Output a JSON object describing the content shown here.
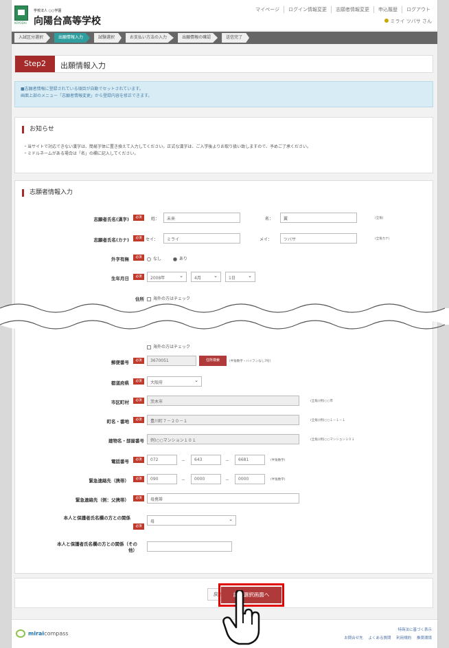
{
  "header": {
    "school_small": "学校法人 ○○学園",
    "school_name": "向陽台高等学校",
    "nav": [
      "マイページ",
      "ログイン情報変更",
      "志願者情報変更",
      "申込履歴",
      "ログアウト"
    ],
    "user": "ミライ ツバサ さん"
  },
  "steps": [
    "入試区分選択",
    "出願情報入力",
    "試験選択",
    "お支払い方法の入力",
    "出願情報の確認",
    "送信完了"
  ],
  "step_title": {
    "badge": "Step2",
    "title": "出願情報入力"
  },
  "info": [
    "■志願者情報に登録されている項目が自動でセットされています。",
    "画面上部のメニュー「志願者情報変更」から登録内容を修正できます。"
  ],
  "notice": {
    "heading": "お知らせ",
    "lines": [
      "・当サイトで対応できない漢字は、簡易字体に置き換えて入力してください。正式な漢字は、ご入学後よりお取り扱い致しますので、予めご了承ください。",
      "・ミドルネームがある場合は「名」の欄に記入してください。"
    ]
  },
  "form": {
    "heading": "志願者情報入力",
    "required": "必須",
    "name_kanji": {
      "label": "志願者氏名(漢字)",
      "sei": "姓：",
      "mei": "名：",
      "sei_val": "未来",
      "mei_val": "翼",
      "note": "(全角)"
    },
    "name_kana": {
      "label": "志願者氏名(カナ)",
      "sei": "セイ：",
      "mei": "メイ：",
      "sei_val": "ミライ",
      "mei_val": "ツバサ",
      "note": "(全角カナ)"
    },
    "gaiji": {
      "label": "外字有無",
      "opt1": "なし",
      "opt2": "あり"
    },
    "birth": {
      "label": "生年月日",
      "year": "2008年",
      "month": "4月",
      "day": "1日"
    },
    "address": {
      "label": "住所",
      "check": "海外の方はチェック"
    },
    "overseas_check": "海外の方はチェック",
    "postal": {
      "label": "郵便番号",
      "value": "3670051",
      "btn": "住所検索",
      "note": "(半角数字・ハイフンなし7桁)"
    },
    "pref": {
      "label": "都道府県",
      "value": "大阪府"
    },
    "city": {
      "label": "市区町村",
      "value": "茨木市",
      "note": "(全角)(例)○○市"
    },
    "town": {
      "label": "町名・番地",
      "value": "豊川町７－２０－１",
      "note": "(全角)(例)○○１－１－１"
    },
    "building": {
      "label": "建物名・部屋番号",
      "value": "例)○○マンション１０１",
      "note": "(全角)(例)○○マンション１０１"
    },
    "tel": {
      "label": "電話番号",
      "a": "072",
      "b": "643",
      "c": "6681",
      "note": "(半角数字)"
    },
    "emergency": {
      "label": "緊急連絡先（携帯）",
      "a": "090",
      "b": "0000",
      "c": "0000",
      "note": "(半角数字)"
    },
    "emergency_name": {
      "label": "緊急連絡先（例：父携帯）",
      "value": "母携帯"
    },
    "relation": {
      "label": "本人と保護者氏名欄の方との関係",
      "value": "母"
    },
    "relation_other": {
      "label": "本人と保護者氏名欄の方との関係（その他）"
    }
  },
  "buttons": {
    "back": "戻る",
    "next": "試験選択画面へ"
  },
  "footer": {
    "brand_bold": "mirai",
    "brand": "compass",
    "r1": "特商法に基づく表示",
    "r2": [
      "お問合せ先",
      "よくある質問",
      "利用規約",
      "推奨環境"
    ]
  }
}
